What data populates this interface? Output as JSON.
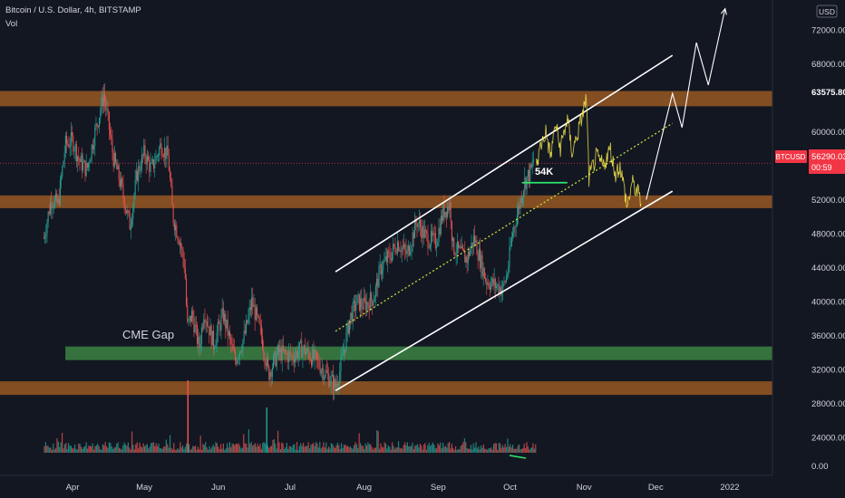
{
  "header": {
    "symbol_title": "Bitcoin / U.S. Dollar, 4h, BITSTAMP",
    "volume_label": "Vol",
    "currency": "USD"
  },
  "price_tag": {
    "symbol": "BTCUSD",
    "price": "56290.03",
    "countdown": "00:59",
    "color": "#f23645"
  },
  "level_tag": {
    "price": "63575.80"
  },
  "annotations": {
    "cme_gap": "CME Gap",
    "level_54k": "54K"
  },
  "colors": {
    "background": "#131722",
    "zone": "#e07b23",
    "gap": "#4caf50",
    "up": "#26a69a",
    "down": "#ef5350",
    "projection": "#f3e34b",
    "midline": "#c6e03a"
  },
  "chart_data": {
    "type": "candlestick",
    "title": "Bitcoin / U.S. Dollar, 4h, BITSTAMP",
    "y_ticks": [
      "72000.00",
      "68000.00",
      "60000.00",
      "52000.00",
      "48000.00",
      "44000.00",
      "40000.00",
      "36000.00",
      "32000.00",
      "28000.00",
      "24000.00"
    ],
    "volume_tick": "0.00",
    "x_ticks": [
      "Apr",
      "May",
      "Jun",
      "Jul",
      "Aug",
      "Sep",
      "Oct",
      "Nov",
      "Dec",
      "2022"
    ],
    "ylim": [
      23000,
      75000
    ],
    "price_series": [
      {
        "t": "2021-03-20",
        "p": 47500
      },
      {
        "t": "2021-03-23",
        "p": 52000
      },
      {
        "t": "2021-03-26",
        "p": 51500
      },
      {
        "t": "2021-03-29",
        "p": 58500
      },
      {
        "t": "2021-04-01",
        "p": 59000
      },
      {
        "t": "2021-04-04",
        "p": 56500
      },
      {
        "t": "2021-04-07",
        "p": 55500
      },
      {
        "t": "2021-04-10",
        "p": 59500
      },
      {
        "t": "2021-04-13",
        "p": 63000
      },
      {
        "t": "2021-04-14",
        "p": 64500
      },
      {
        "t": "2021-04-16",
        "p": 61000
      },
      {
        "t": "2021-04-18",
        "p": 57000
      },
      {
        "t": "2021-04-21",
        "p": 54000
      },
      {
        "t": "2021-04-25",
        "p": 49000
      },
      {
        "t": "2021-04-28",
        "p": 55000
      },
      {
        "t": "2021-05-01",
        "p": 57500
      },
      {
        "t": "2021-05-04",
        "p": 55500
      },
      {
        "t": "2021-05-08",
        "p": 58500
      },
      {
        "t": "2021-05-11",
        "p": 57000
      },
      {
        "t": "2021-05-13",
        "p": 50000
      },
      {
        "t": "2021-05-16",
        "p": 47000
      },
      {
        "t": "2021-05-18",
        "p": 44000
      },
      {
        "t": "2021-05-19",
        "p": 37000
      },
      {
        "t": "2021-05-21",
        "p": 38500
      },
      {
        "t": "2021-05-24",
        "p": 34500
      },
      {
        "t": "2021-05-26",
        "p": 39000
      },
      {
        "t": "2021-05-30",
        "p": 35000
      },
      {
        "t": "2021-06-03",
        "p": 38500
      },
      {
        "t": "2021-06-08",
        "p": 33000
      },
      {
        "t": "2021-06-12",
        "p": 36000
      },
      {
        "t": "2021-06-15",
        "p": 40000
      },
      {
        "t": "2021-06-19",
        "p": 36000
      },
      {
        "t": "2021-06-22",
        "p": 31500
      },
      {
        "t": "2021-06-26",
        "p": 34000
      },
      {
        "t": "2021-07-02",
        "p": 33500
      },
      {
        "t": "2021-07-06",
        "p": 34500
      },
      {
        "t": "2021-07-12",
        "p": 33000
      },
      {
        "t": "2021-07-16",
        "p": 31500
      },
      {
        "t": "2021-07-20",
        "p": 30000
      },
      {
        "t": "2021-07-22",
        "p": 32000
      },
      {
        "t": "2021-07-26",
        "p": 38000
      },
      {
        "t": "2021-07-29",
        "p": 40000
      },
      {
        "t": "2021-08-01",
        "p": 39500
      },
      {
        "t": "2021-08-05",
        "p": 40500
      },
      {
        "t": "2021-08-08",
        "p": 44000
      },
      {
        "t": "2021-08-12",
        "p": 45500
      },
      {
        "t": "2021-08-15",
        "p": 47000
      },
      {
        "t": "2021-08-19",
        "p": 45500
      },
      {
        "t": "2021-08-23",
        "p": 49500
      },
      {
        "t": "2021-08-27",
        "p": 47500
      },
      {
        "t": "2021-08-31",
        "p": 47000
      },
      {
        "t": "2021-09-03",
        "p": 50500
      },
      {
        "t": "2021-09-06",
        "p": 51500
      },
      {
        "t": "2021-09-07",
        "p": 46500
      },
      {
        "t": "2021-09-09",
        "p": 46000
      },
      {
        "t": "2021-09-13",
        "p": 45000
      },
      {
        "t": "2021-09-16",
        "p": 47500
      },
      {
        "t": "2021-09-21",
        "p": 42500
      },
      {
        "t": "2021-09-24",
        "p": 42000
      },
      {
        "t": "2021-09-28",
        "p": 41500
      },
      {
        "t": "2021-09-30",
        "p": 43500
      },
      {
        "t": "2021-10-02",
        "p": 48000
      },
      {
        "t": "2021-10-05",
        "p": 51500
      },
      {
        "t": "2021-10-07",
        "p": 54000
      },
      {
        "t": "2021-10-10",
        "p": 55500
      },
      {
        "t": "2021-10-11",
        "p": 57000
      }
    ],
    "projection": [
      {
        "t": "2021-10-12",
        "p": 56000
      },
      {
        "t": "2021-10-14",
        "p": 58500
      },
      {
        "t": "2021-10-16",
        "p": 60000
      },
      {
        "t": "2021-10-18",
        "p": 57000
      },
      {
        "t": "2021-10-20",
        "p": 61000
      },
      {
        "t": "2021-10-22",
        "p": 58000
      },
      {
        "t": "2021-10-25",
        "p": 61500
      },
      {
        "t": "2021-10-27",
        "p": 57500
      },
      {
        "t": "2021-10-30",
        "p": 60500
      },
      {
        "t": "2021-11-02",
        "p": 64000
      },
      {
        "t": "2021-11-03",
        "p": 54500
      },
      {
        "t": "2021-11-06",
        "p": 57000
      },
      {
        "t": "2021-11-09",
        "p": 56000
      },
      {
        "t": "2021-11-12",
        "p": 58000
      },
      {
        "t": "2021-11-14",
        "p": 55000
      },
      {
        "t": "2021-11-16",
        "p": 56000
      },
      {
        "t": "2021-11-18",
        "p": 53000
      },
      {
        "t": "2021-11-19",
        "p": 51000
      },
      {
        "t": "2021-11-21",
        "p": 54000
      },
      {
        "t": "2021-11-24",
        "p": 52500
      },
      {
        "t": "2021-11-25",
        "p": 51500
      }
    ],
    "forecast_path": [
      {
        "t": "2021-11-27",
        "p": 52000
      },
      {
        "t": "2021-12-08",
        "p": 64500
      },
      {
        "t": "2021-12-12",
        "p": 60500
      },
      {
        "t": "2021-12-18",
        "p": 70500
      },
      {
        "t": "2021-12-23",
        "p": 65500
      },
      {
        "t": "2021-12-30",
        "p": 74500
      }
    ],
    "zones": [
      {
        "from": 63000,
        "to": 64800,
        "color": "#e07b23"
      },
      {
        "from": 51000,
        "to": 52500,
        "color": "#e07b23"
      },
      {
        "from": 29000,
        "to": 30600,
        "color": "#e07b23"
      }
    ],
    "cme_gap": {
      "from": 33100,
      "to": 34700,
      "start": "2021-03-29",
      "end": "2022-01-31"
    },
    "channel": {
      "upper": [
        {
          "t": "2021-07-20",
          "p": 43500
        },
        {
          "t": "2021-12-08",
          "p": 69000
        }
      ],
      "lower": [
        {
          "t": "2021-07-20",
          "p": 29500
        },
        {
          "t": "2021-12-08",
          "p": 53000
        }
      ],
      "midline": [
        {
          "t": "2021-07-20",
          "p": 36500
        },
        {
          "t": "2021-12-08",
          "p": 61000
        }
      ]
    },
    "level_54k": {
      "price": 54000,
      "from": "2021-10-06",
      "to": "2021-10-25"
    },
    "volume": {
      "type": "bar",
      "mode": "relative",
      "start": "2021-03-20",
      "end": "2021-10-12"
    }
  }
}
